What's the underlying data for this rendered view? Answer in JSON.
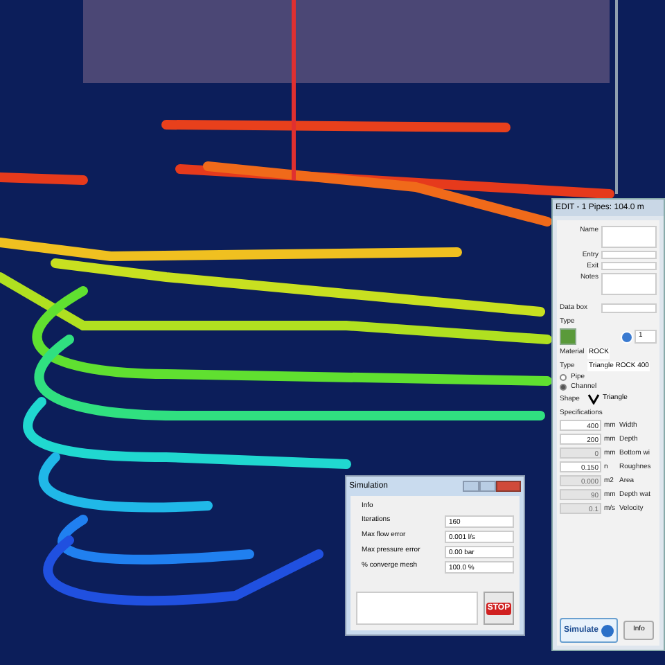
{
  "edit_panel": {
    "title": "EDIT - 1 Pipes: 104.0 m",
    "fields": [
      {
        "label": "Name",
        "tall": true
      },
      {
        "label": "Entry",
        "tall": false
      },
      {
        "label": "Exit",
        "tall": false
      },
      {
        "label": "Notes",
        "tall": true
      }
    ],
    "data_box": {
      "label": "Data box"
    },
    "type_section": {
      "heading": "Type",
      "count": "1"
    },
    "material": {
      "label": "Material",
      "value": "ROCK"
    },
    "type": {
      "label": "Type",
      "value": "Triangle ROCK  400"
    },
    "radios": [
      {
        "label": "Pipe",
        "selected": false
      },
      {
        "label": "Channel",
        "selected": true
      }
    ],
    "shape": {
      "label": "Shape",
      "value": "Triangle"
    },
    "specifications": {
      "heading": "Specifications",
      "rows": [
        {
          "value": "400",
          "unit": "mm",
          "name": "Width",
          "disabled": false
        },
        {
          "value": "200",
          "unit": "mm",
          "name": "Depth",
          "disabled": false
        },
        {
          "value": "0",
          "unit": "mm",
          "name": "Bottom wi",
          "disabled": true
        },
        {
          "value": "0.150",
          "unit": "n",
          "name": "Roughnes",
          "disabled": false
        },
        {
          "value": "0.000",
          "unit": "m2",
          "name": "Area",
          "disabled": true
        },
        {
          "value": "90",
          "unit": "mm",
          "name": "Depth wat",
          "disabled": true
        },
        {
          "value": "0.1",
          "unit": "m/s",
          "name": "Velocity",
          "disabled": true
        }
      ]
    },
    "buttons": [
      {
        "kind": "simulate",
        "label": "Simulate"
      },
      {
        "kind": "plain",
        "label": "Info"
      }
    ]
  },
  "simulation": {
    "title": "Simulation",
    "section": "Info",
    "rows": [
      {
        "label": "Iterations",
        "value": "160"
      },
      {
        "label": "Max flow error",
        "value": "0.001 l/s"
      },
      {
        "label": "Max pressure error",
        "value": "0.00 bar"
      },
      {
        "label": "% converge mesh",
        "value": "100.0 %"
      }
    ],
    "stop": "STOP"
  }
}
